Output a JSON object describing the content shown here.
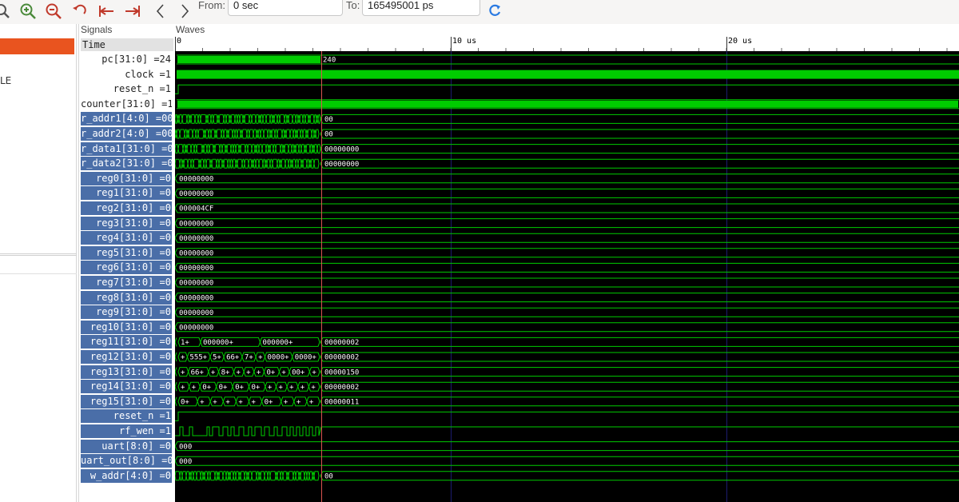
{
  "toolbar": {
    "from_label": "From:",
    "from_value": "0 sec",
    "to_label": "To:",
    "to_value": "165495001 ps",
    "icons": [
      "zoom-fit-icon",
      "zoom-in-icon",
      "zoom-out-icon",
      "undo-icon",
      "goto-start-icon",
      "goto-end-icon",
      "prev-icon",
      "next-icon",
      "reload-icon"
    ]
  },
  "left": {
    "label": "LE"
  },
  "signals": {
    "title": "Signals",
    "time_header": "Time",
    "rows": [
      {
        "label": "pc[31:0] =24",
        "highlight": false
      },
      {
        "label": "clock =1",
        "highlight": false
      },
      {
        "label": "reset_n =1",
        "highlight": false
      },
      {
        "label": "counter[31:0] =1!",
        "highlight": false
      },
      {
        "label": "r_addr1[4:0] =00",
        "highlight": true
      },
      {
        "label": "r_addr2[4:0] =00",
        "highlight": true
      },
      {
        "label": "r_data1[31:0] =0",
        "highlight": true
      },
      {
        "label": "r_data2[31:0] =0",
        "highlight": true
      },
      {
        "label": "reg0[31:0] =0",
        "highlight": true
      },
      {
        "label": "reg1[31:0] =0",
        "highlight": true
      },
      {
        "label": "reg2[31:0] =0",
        "highlight": true
      },
      {
        "label": "reg3[31:0] =0",
        "highlight": true
      },
      {
        "label": "reg4[31:0] =0",
        "highlight": true
      },
      {
        "label": "reg5[31:0] =0",
        "highlight": true
      },
      {
        "label": "reg6[31:0] =0",
        "highlight": true
      },
      {
        "label": "reg7[31:0] =0",
        "highlight": true
      },
      {
        "label": "reg8[31:0] =0",
        "highlight": true
      },
      {
        "label": "reg9[31:0] =0",
        "highlight": true
      },
      {
        "label": "reg10[31:0] =0",
        "highlight": true
      },
      {
        "label": "reg11[31:0] =0",
        "highlight": true
      },
      {
        "label": "reg12[31:0] =0",
        "highlight": true
      },
      {
        "label": "reg13[31:0] =0",
        "highlight": true
      },
      {
        "label": "reg14[31:0] =0",
        "highlight": true
      },
      {
        "label": "reg15[31:0] =0",
        "highlight": true
      },
      {
        "label": "reset_n =1",
        "highlight": true
      },
      {
        "label": "rf_wen =1",
        "highlight": true
      },
      {
        "label": "uart[8:0] =0",
        "highlight": true
      },
      {
        "label": "uart_out[8:0] =0",
        "highlight": true
      },
      {
        "label": "w_addr[4:0] =0",
        "highlight": true
      }
    ]
  },
  "waves": {
    "title": "Waves",
    "ruler_labels": [
      "0",
      "10 us",
      "20 us"
    ],
    "colors": {
      "wave": "#00cc00",
      "bus_fill": "#00cc00",
      "cursor": "#d9534f",
      "grid": "#1c1c6e",
      "background": "#000000"
    },
    "rows": [
      {
        "kind": "dense_bus",
        "value": "240"
      },
      {
        "kind": "clock_band",
        "value": ""
      },
      {
        "kind": "reset",
        "value": ""
      },
      {
        "kind": "dense_bus",
        "value": ""
      },
      {
        "kind": "bus_activity",
        "value": "00"
      },
      {
        "kind": "bus_activity",
        "value": "00"
      },
      {
        "kind": "bus_activity",
        "value": "00000000"
      },
      {
        "kind": "bus_activity",
        "value": "00000000"
      },
      {
        "kind": "bus_const",
        "value": "00000000"
      },
      {
        "kind": "bus_const",
        "value": "00000000"
      },
      {
        "kind": "bus_const",
        "value": "000004CF"
      },
      {
        "kind": "bus_const",
        "value": "00000000"
      },
      {
        "kind": "bus_const",
        "value": "00000000"
      },
      {
        "kind": "bus_const",
        "value": "00000000"
      },
      {
        "kind": "bus_const",
        "value": "00000000"
      },
      {
        "kind": "bus_const",
        "value": "00000000"
      },
      {
        "kind": "bus_const",
        "value": "00000000"
      },
      {
        "kind": "bus_const",
        "value": "00000000"
      },
      {
        "kind": "bus_const",
        "value": "00000000"
      },
      {
        "kind": "bus_segments",
        "value": "00000002",
        "segments": [
          "1+",
          "000000+",
          "000000+"
        ]
      },
      {
        "kind": "bus_segments",
        "value": "00000002",
        "segments": [
          "+",
          "555+",
          "5+",
          "66+",
          "7+",
          "+",
          "0000+",
          "0000+"
        ]
      },
      {
        "kind": "bus_segments",
        "value": "00000150",
        "segments": [
          "+",
          "66+",
          "+",
          "8+",
          "+",
          "+",
          "+",
          "0+",
          "+",
          "00+",
          "+"
        ]
      },
      {
        "kind": "bus_segments",
        "value": "00000002",
        "segments": [
          "+",
          "+",
          "0+",
          "0+",
          "0+",
          "0+",
          "+",
          "+",
          "+",
          "+",
          "+"
        ]
      },
      {
        "kind": "bus_segments",
        "value": "00000011",
        "segments": [
          "0+",
          "+",
          "+",
          "+",
          "+",
          "+",
          "0+",
          "+",
          "+",
          "+"
        ]
      },
      {
        "kind": "reset",
        "value": ""
      },
      {
        "kind": "rf_wen",
        "value": ""
      },
      {
        "kind": "bus_const",
        "value": "000"
      },
      {
        "kind": "bus_const",
        "value": "000"
      },
      {
        "kind": "bus_activity",
        "value": "00"
      }
    ]
  }
}
